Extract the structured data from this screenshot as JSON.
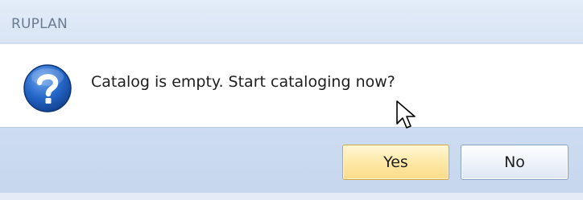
{
  "window": {
    "title": "RUPLAN"
  },
  "dialog": {
    "icon": "question-icon",
    "message": "Catalog is empty. Start cataloging now?"
  },
  "buttons": {
    "yes_label": "Yes",
    "no_label": "No"
  },
  "colors": {
    "title_bar": "#dae6f6",
    "footer": "#c6d7ee",
    "icon_blue": "#1f5fbf",
    "default_button_border": "#d3a640"
  }
}
